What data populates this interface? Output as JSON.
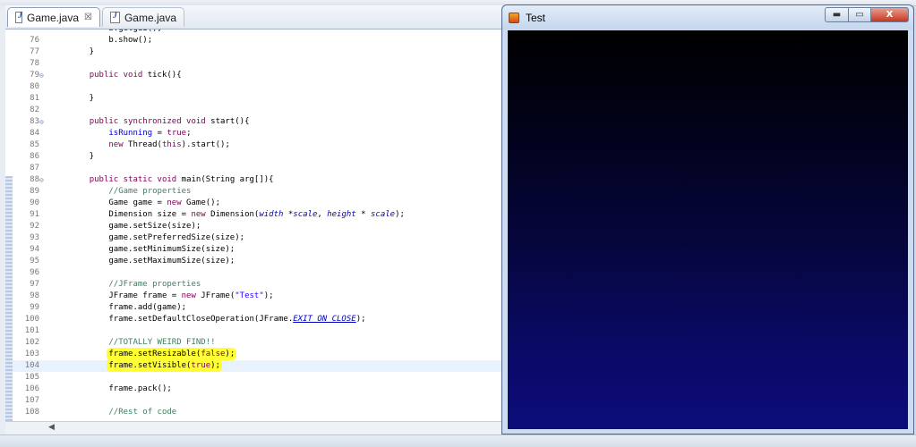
{
  "editor": {
    "tabs": [
      {
        "label": "Game.java",
        "close": "☒"
      },
      {
        "label": "Game.java"
      }
    ],
    "lines": [
      {
        "n": "",
        "c": "        <span>b.getgui();</span>"
      },
      {
        "n": "76",
        "c": "        b.show();"
      },
      {
        "n": "77",
        "c": "    }"
      },
      {
        "n": "78",
        "c": ""
      },
      {
        "n": "79⊖",
        "c": "    <span class=\"kw\">public void</span> tick(){"
      },
      {
        "n": "80",
        "c": ""
      },
      {
        "n": "81",
        "c": "    }"
      },
      {
        "n": "82",
        "c": ""
      },
      {
        "n": "83⊖",
        "c": "    <span class=\"kw\">public synchronized void</span> start(){"
      },
      {
        "n": "84",
        "c": "        <span class=\"fld\">isRunning</span> = <span class=\"kw\">true</span>;"
      },
      {
        "n": "85",
        "c": "        <span class=\"kw\">new</span> Thread(<span class=\"kw\">this</span>).start();"
      },
      {
        "n": "86",
        "c": "    }"
      },
      {
        "n": "87",
        "c": ""
      },
      {
        "n": "88⊖",
        "c": "    <span class=\"kw\">public static void</span> main(String arg[]){"
      },
      {
        "n": "89",
        "c": "        <span class=\"cm\">//Game properties</span>"
      },
      {
        "n": "90",
        "c": "        Game game = <span class=\"kw\">new</span> Game();"
      },
      {
        "n": "91",
        "c": "        Dimension size = <span class=\"kw\">new</span> Dimension(<span class=\"it\">width</span> *<span class=\"it\">scale</span>, <span class=\"it\">height</span> * <span class=\"it\">scale</span>);"
      },
      {
        "n": "92",
        "c": "        game.setSize(size);"
      },
      {
        "n": "93",
        "c": "        game.setPreferredSize(size);"
      },
      {
        "n": "94",
        "c": "        game.setMinimumSize(size);"
      },
      {
        "n": "95",
        "c": "        game.setMaximumSize(size);"
      },
      {
        "n": "96",
        "c": ""
      },
      {
        "n": "97",
        "c": "        <span class=\"cm\">//JFrame properties</span>"
      },
      {
        "n": "98",
        "c": "        JFrame frame = <span class=\"kw\">new</span> JFrame(<span class=\"st\">\"Test\"</span>);"
      },
      {
        "n": "99",
        "c": "        frame.add(game);"
      },
      {
        "n": "100",
        "c": "        frame.setDefaultCloseOperation(JFrame.<span class=\"it\"><u>EXIT_ON_CLOSE</u></span>);"
      },
      {
        "n": "101",
        "c": ""
      },
      {
        "n": "102",
        "c": "        <span class=\"cm\">//TOTALLY WEIRD FIND!!</span>"
      },
      {
        "n": "103",
        "c": "        <span class=\"hl\">frame.setResizable(<span class=\"kw\">false</span>);</span>"
      },
      {
        "n": "104",
        "c": "        <span class=\"hl\">frame.setVisible(<span class=\"kw\">true</span>);</span>",
        "current": true
      },
      {
        "n": "105",
        "c": ""
      },
      {
        "n": "106",
        "c": "        frame.pack();"
      },
      {
        "n": "107",
        "c": ""
      },
      {
        "n": "108",
        "c": "        <span class=\"cm\">//Rest of code</span>"
      }
    ],
    "hscroll_arrow": "◀"
  },
  "window": {
    "title": "Test",
    "min_glyph": "▬",
    "max_glyph": "▭",
    "close_glyph": "X"
  }
}
